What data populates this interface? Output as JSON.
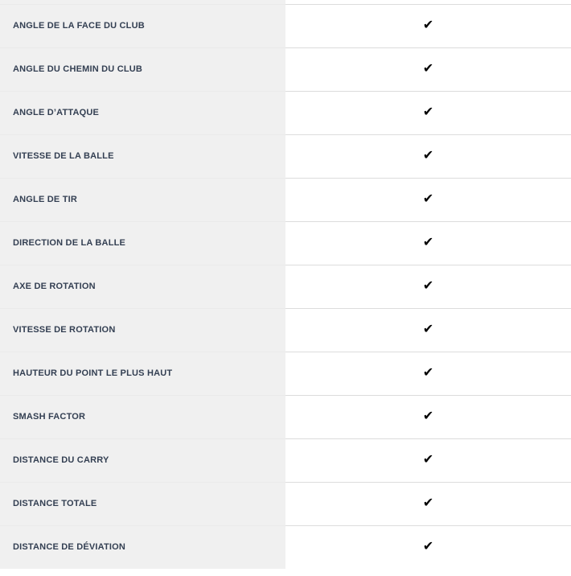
{
  "table": {
    "columns": [
      {
        "key": "metric",
        "header": ""
      },
      {
        "key": "supported",
        "header": ""
      }
    ],
    "check_glyph": "✔",
    "icon_name": "check-icon",
    "colors": {
      "label_background": "#f0f0f0",
      "value_background": "#ffffff",
      "label_text": "#333f52",
      "row_border": "#dcdcdc",
      "check_mark": "#000000"
    },
    "rows": [
      {
        "label": "ANGLE DE LA FACE DU CLUB",
        "supported": "✔"
      },
      {
        "label": "ANGLE DU CHEMIN DU CLUB",
        "supported": "✔"
      },
      {
        "label": "ANGLE D’ATTAQUE",
        "supported": "✔"
      },
      {
        "label": "VITESSE DE LA BALLE",
        "supported": "✔"
      },
      {
        "label": "ANGLE DE TIR",
        "supported": "✔"
      },
      {
        "label": "DIRECTION DE LA BALLE",
        "supported": "✔"
      },
      {
        "label": "AXE DE ROTATION",
        "supported": "✔"
      },
      {
        "label": "VITESSE DE ROTATION",
        "supported": "✔"
      },
      {
        "label": "HAUTEUR DU POINT LE PLUS HAUT",
        "supported": "✔"
      },
      {
        "label": "SMASH FACTOR",
        "supported": "✔"
      },
      {
        "label": "DISTANCE DU CARRY",
        "supported": "✔"
      },
      {
        "label": "DISTANCE TOTALE",
        "supported": "✔"
      },
      {
        "label": "DISTANCE DE DÉVIATION",
        "supported": "✔"
      }
    ]
  }
}
